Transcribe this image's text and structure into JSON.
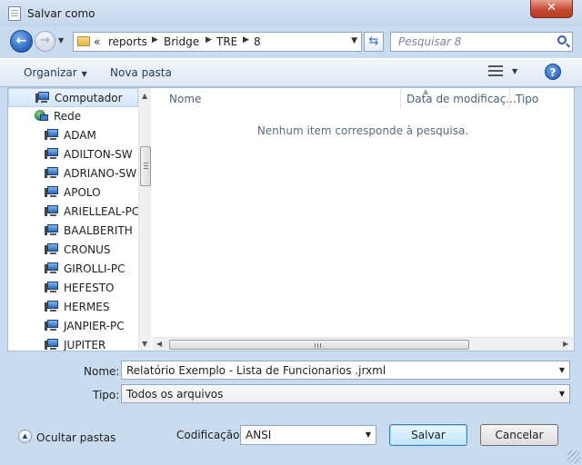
{
  "window": {
    "title": "Salvar como",
    "close_symbol": "✕"
  },
  "address_bar": {
    "overflow": "«",
    "crumbs": [
      "reports",
      "Bridge",
      "TRE",
      "8"
    ],
    "search_placeholder": "Pesquisar 8"
  },
  "toolbar": {
    "organize_label": "Organizar",
    "new_folder_label": "Nova pasta",
    "help_symbol": "?"
  },
  "nav_pane": {
    "items": [
      {
        "label": "Computador",
        "icon": "computer-icon",
        "selected": true
      },
      {
        "label": "Rede",
        "icon": "network-icon"
      },
      {
        "label": "ADAM",
        "icon": "computer-icon"
      },
      {
        "label": "ADILTON-SW",
        "icon": "computer-icon"
      },
      {
        "label": "ADRIANO-SW",
        "icon": "computer-icon"
      },
      {
        "label": "APOLO",
        "icon": "computer-icon"
      },
      {
        "label": "ARIELLEAL-PC",
        "icon": "computer-icon"
      },
      {
        "label": "BAALBERITH",
        "icon": "computer-icon"
      },
      {
        "label": "CRONUS",
        "icon": "computer-icon"
      },
      {
        "label": "GIROLLI-PC",
        "icon": "computer-icon"
      },
      {
        "label": "HEFESTO",
        "icon": "computer-icon"
      },
      {
        "label": "HERMES",
        "icon": "computer-icon"
      },
      {
        "label": "JANPIER-PC",
        "icon": "computer-icon"
      },
      {
        "label": "JUPITER",
        "icon": "computer-icon"
      }
    ]
  },
  "file_list": {
    "columns": [
      "Nome",
      "Data de modificaç...",
      "Tipo"
    ],
    "empty_message": "Nenhum item corresponde à pesquisa."
  },
  "form": {
    "name_label": "Nome:",
    "name_value": "Relatório Exemplo - Lista de Funcionarios .jrxml",
    "type_label": "Tipo:",
    "type_value": "Todos os arquivos",
    "encoding_label": "Codificação:",
    "encoding_value": "ANSI"
  },
  "footer": {
    "hide_folders_label": "Ocultar pastas",
    "save_label": "Salvar",
    "cancel_label": "Cancelar"
  },
  "colors": {
    "accent": "#2f6cc4",
    "frame": "#c9dbee",
    "close": "#c74a34"
  }
}
